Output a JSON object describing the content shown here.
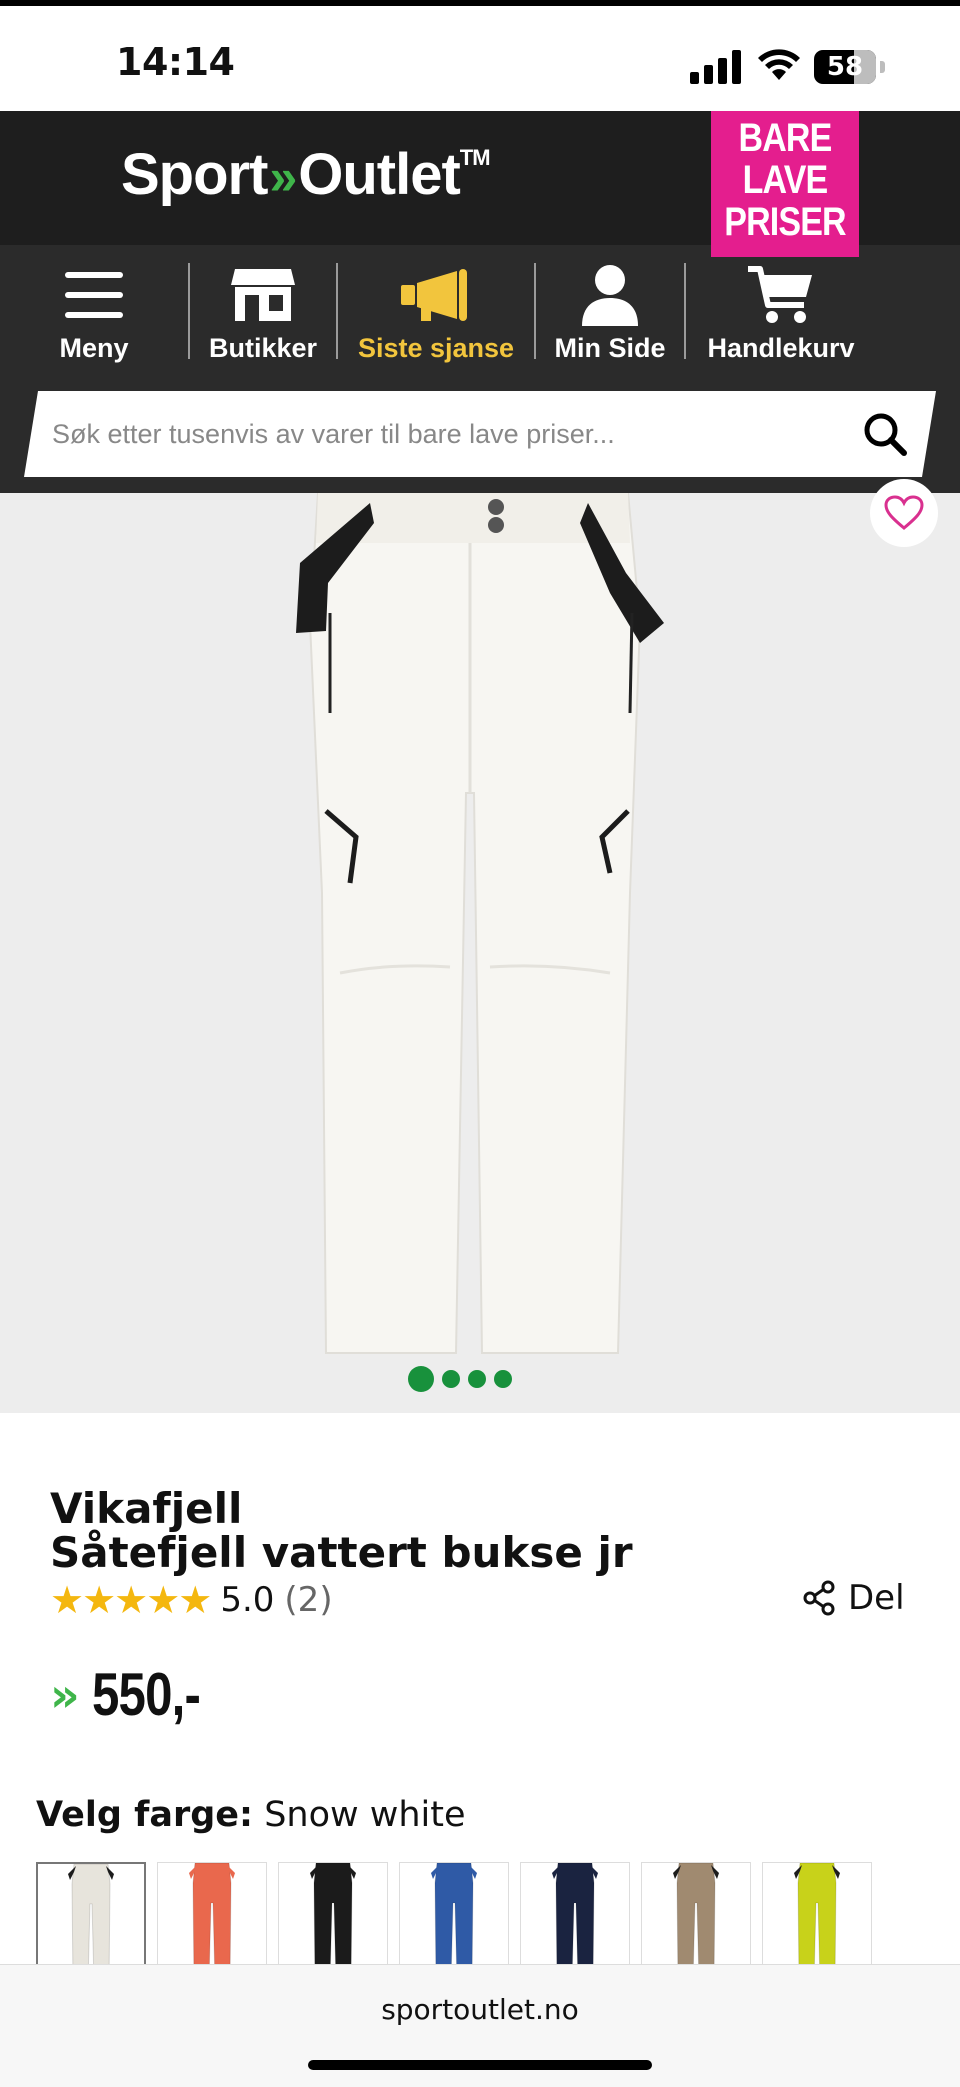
{
  "status_bar": {
    "time": "14:14",
    "battery": "58"
  },
  "header": {
    "logo_part1": "Sport",
    "logo_chevron": "»",
    "logo_part2": "Outlet",
    "logo_tm": "TM",
    "badge_lines": [
      "BARE",
      "LAVE",
      "PRISER"
    ]
  },
  "nav": {
    "items": [
      {
        "label": "Meny",
        "icon": "menu-icon"
      },
      {
        "label": "Butikker",
        "icon": "store-icon"
      },
      {
        "label": "Siste sjanse",
        "icon": "megaphone-icon",
        "active": true
      },
      {
        "label": "Min Side",
        "icon": "user-icon"
      },
      {
        "label": "Handlekurv",
        "icon": "cart-icon"
      }
    ]
  },
  "search": {
    "placeholder": "Søk etter tusenvis av varer til bare lave priser..."
  },
  "gallery": {
    "image_count": 4,
    "current_index": 1
  },
  "product": {
    "brand": "Vikafjell",
    "name": "Såtefjell vattert bukse jr",
    "stars": "★★★★★",
    "rating": "5.0",
    "review_count": "(2)",
    "share_label": "Del",
    "price_chevron": "»",
    "price": "550,-"
  },
  "color_picker": {
    "label": "Velg farge:",
    "selected": "Snow white",
    "swatches": [
      {
        "color": "#e7e4dc",
        "icon": "pants-thumbnail"
      },
      {
        "color": "#e9684d",
        "icon": "pants-thumbnail"
      },
      {
        "color": "#1b1b1b",
        "icon": "pants-thumbnail"
      },
      {
        "color": "#2f5aa6",
        "icon": "pants-thumbnail"
      },
      {
        "color": "#1a2340",
        "icon": "pants-thumbnail"
      },
      {
        "color": "#a08a70",
        "icon": "pants-thumbnail"
      },
      {
        "color": "#c8d21a",
        "icon": "pants-thumbnail"
      }
    ]
  },
  "browser": {
    "url": "sportoutlet.no"
  },
  "colors": {
    "accent_green": "#3fb54a",
    "badge_pink": "#e41e8e",
    "active_nav": "#f2c53d",
    "star": "#f4b70f",
    "header_bg": "#1e1e1e"
  }
}
